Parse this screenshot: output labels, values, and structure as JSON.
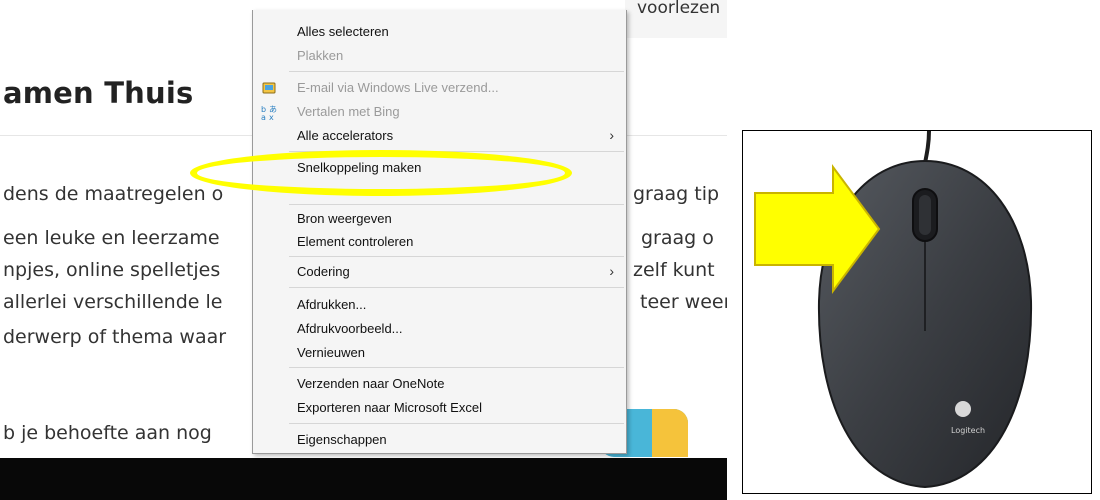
{
  "webpage": {
    "top_text": "voorlezen",
    "heading": "amen Thuis",
    "paragraph_left": [
      "dens de maatregelen o",
      "een leuke en leerzame",
      "npjes, online spelletjes",
      "allerlei verschillende le",
      "derwerp of thema waar"
    ],
    "paragraph_right": [
      "graag tip",
      "graag o",
      "zelf kunt",
      "teer weer"
    ],
    "bottom_line": "b je behoefte aan nog"
  },
  "context_menu": {
    "items": [
      {
        "label": "Alles selecteren",
        "disabled": false
      },
      {
        "label": "Plakken",
        "disabled": true
      },
      {
        "label": "E-mail via Windows Live verzend...",
        "disabled": true,
        "icon": "windows-live-mail-icon"
      },
      {
        "label": "Vertalen met Bing",
        "disabled": true,
        "icon": "bing-translate-icon"
      },
      {
        "label": "Alle accelerators",
        "disabled": false,
        "submenu": true
      },
      {
        "label": "Snelkoppeling maken",
        "disabled": false
      },
      {
        "label": "Bron weergeven",
        "disabled": false
      },
      {
        "label": "Element controleren",
        "disabled": false
      },
      {
        "label": "Codering",
        "disabled": false,
        "submenu": true
      },
      {
        "label": "Afdrukken...",
        "disabled": false
      },
      {
        "label": "Afdrukvoorbeeld...",
        "disabled": false
      },
      {
        "label": "Vernieuwen",
        "disabled": false
      },
      {
        "label": "Verzenden naar OneNote",
        "disabled": false
      },
      {
        "label": "Exporteren naar Microsoft Excel",
        "disabled": false
      },
      {
        "label": "Eigenschappen",
        "disabled": false
      }
    ],
    "submenu_arrow": "›"
  },
  "highlight": {
    "color": "#ffff00",
    "target": "Snelkoppeling maken"
  },
  "mouse_image": {
    "brand": "Logitech",
    "arrow_color": "#ffff00",
    "arrow_points_to": "right-mouse-button"
  },
  "colors": {
    "menu_bg": "#f5f5f5",
    "disabled_text": "#9a9a9a",
    "mouse_body": "#3a3d41"
  }
}
